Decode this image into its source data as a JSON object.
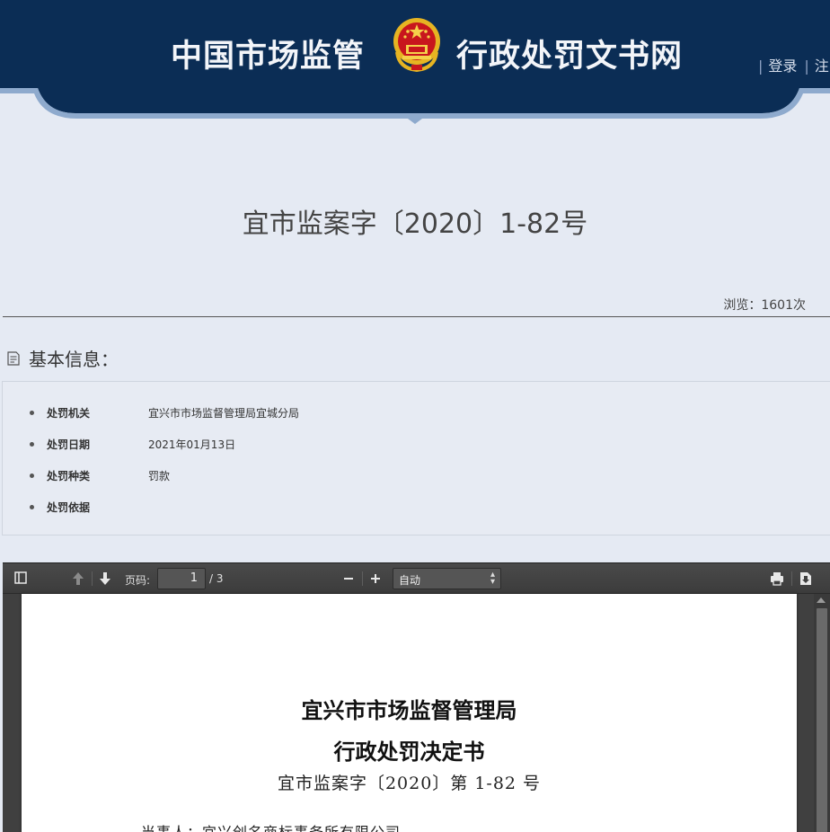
{
  "header": {
    "brand_left": "中国市场监管",
    "brand_right": "行政处罚文书网",
    "emblem_icon": "national-emblem-icon",
    "links": [
      "登录",
      "注"
    ],
    "colors": {
      "bar": "#0b2d55",
      "accent": "#8eaacd",
      "text": "#f3f5f9"
    }
  },
  "document": {
    "title": "宜市监案字〔2020〕1-82号",
    "views": "浏览：1601次"
  },
  "basic_info": {
    "heading": "基本信息：",
    "rows": [
      {
        "key": "处罚机关",
        "value": "宜兴市市场监督管理局宜城分局"
      },
      {
        "key": "处罚日期",
        "value": "2021年01月13日"
      },
      {
        "key": "处罚种类",
        "value": "罚款"
      },
      {
        "key": "处罚依据",
        "value": ""
      }
    ]
  },
  "viewer": {
    "page_label": "页码:",
    "page_value": "1",
    "page_total": "/ 3",
    "zoom_value": "自动",
    "icons": [
      "sidebar-toggle-icon",
      "previous-page-icon",
      "next-page-icon",
      "zoom-out-icon",
      "zoom-in-icon",
      "print-icon",
      "download-icon"
    ],
    "pdf": {
      "heading1": "宜兴市市场监督管理局",
      "heading2": "行政处罚决定书",
      "doc_number": "宜市监案字〔2020〕第 1-82 号",
      "party": "当事人：宜兴创名商标事务所有限公司"
    }
  }
}
